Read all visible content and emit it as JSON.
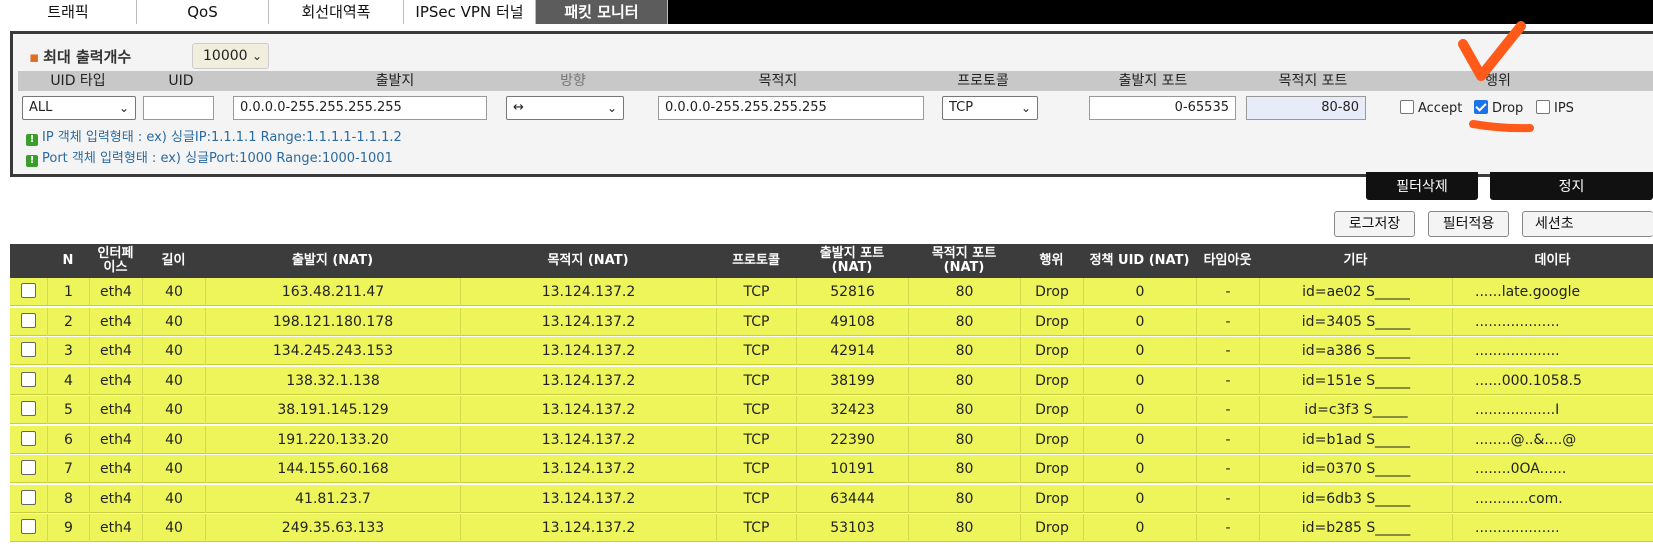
{
  "tabs": [
    {
      "label": "트래픽",
      "active": false
    },
    {
      "label": "QoS",
      "active": false
    },
    {
      "label": "회선대역폭",
      "active": false
    },
    {
      "label": "IPSec VPN 터널",
      "active": false
    },
    {
      "label": "패킷 모니터",
      "active": true
    }
  ],
  "filter": {
    "max_output_label": "최대 출력개수",
    "max_output_value": "10000",
    "headers": {
      "uid_type": "UID 타입",
      "uid": "UID",
      "source": "출발지",
      "direction": "방향",
      "destination": "목적지",
      "protocol": "프로토콜",
      "source_port": "출발지 포트",
      "dest_port": "목적지 포트",
      "action": "행위"
    },
    "uid_type_value": "ALL",
    "uid_value": "",
    "source_value": "0.0.0.0-255.255.255.255",
    "direction_value": "↔",
    "destination_value": "0.0.0.0-255.255.255.255",
    "protocol_value": "TCP",
    "source_port_value": "0-65535",
    "dest_port_value": "80-80",
    "actions": [
      {
        "label": "Accept",
        "checked": false
      },
      {
        "label": "Drop",
        "checked": true
      },
      {
        "label": "IPS",
        "checked": false
      }
    ],
    "notes": [
      "IP 객체 입력형태 : ex) 싱글IP:1.1.1.1 Range:1.1.1.1-1.1.1.2",
      "Port 객체 입력형태 : ex) 싱글Port:1000 Range:1000-1001"
    ]
  },
  "buttons": {
    "filter_delete": "필터삭제",
    "stop": "정지",
    "log_save": "로그저장",
    "filter_apply": "필터적용",
    "session": "세션초"
  },
  "table": {
    "headers": [
      "N",
      "인터페\n이스",
      "길이",
      "출발지 (NAT)",
      "목적지 (NAT)",
      "프로토콜",
      "출발지 포트\n(NAT)",
      "목적지 포트\n(NAT)",
      "행위",
      "정책 UID (NAT)",
      "타임아웃",
      "기타",
      "데이타"
    ],
    "rows": [
      {
        "n": "1",
        "iface": "eth4",
        "len": "40",
        "src": "163.48.211.47",
        "dst": "13.124.137.2",
        "proto": "TCP",
        "sport": "52816",
        "dport": "80",
        "action": "Drop",
        "uid": "0",
        "timeout": "-",
        "etc": "id=ae02 S_____",
        "data": "......late.google"
      },
      {
        "n": "2",
        "iface": "eth4",
        "len": "40",
        "src": "198.121.180.178",
        "dst": "13.124.137.2",
        "proto": "TCP",
        "sport": "49108",
        "dport": "80",
        "action": "Drop",
        "uid": "0",
        "timeout": "-",
        "etc": "id=3405 S_____",
        "data": "..................."
      },
      {
        "n": "3",
        "iface": "eth4",
        "len": "40",
        "src": "134.245.243.153",
        "dst": "13.124.137.2",
        "proto": "TCP",
        "sport": "42914",
        "dport": "80",
        "action": "Drop",
        "uid": "0",
        "timeout": "-",
        "etc": "id=a386 S_____",
        "data": "..................."
      },
      {
        "n": "4",
        "iface": "eth4",
        "len": "40",
        "src": "138.32.1.138",
        "dst": "13.124.137.2",
        "proto": "TCP",
        "sport": "38199",
        "dport": "80",
        "action": "Drop",
        "uid": "0",
        "timeout": "-",
        "etc": "id=151e S_____",
        "data": "......000.1058.5"
      },
      {
        "n": "5",
        "iface": "eth4",
        "len": "40",
        "src": "38.191.145.129",
        "dst": "13.124.137.2",
        "proto": "TCP",
        "sport": "32423",
        "dport": "80",
        "action": "Drop",
        "uid": "0",
        "timeout": "-",
        "etc": "id=c3f3 S_____",
        "data": "..................I"
      },
      {
        "n": "6",
        "iface": "eth4",
        "len": "40",
        "src": "191.220.133.20",
        "dst": "13.124.137.2",
        "proto": "TCP",
        "sport": "22390",
        "dport": "80",
        "action": "Drop",
        "uid": "0",
        "timeout": "-",
        "etc": "id=b1ad S_____",
        "data": "........@..&....@"
      },
      {
        "n": "7",
        "iface": "eth4",
        "len": "40",
        "src": "144.155.60.168",
        "dst": "13.124.137.2",
        "proto": "TCP",
        "sport": "10191",
        "dport": "80",
        "action": "Drop",
        "uid": "0",
        "timeout": "-",
        "etc": "id=0370 S_____",
        "data": "........0OA......"
      },
      {
        "n": "8",
        "iface": "eth4",
        "len": "40",
        "src": "41.81.23.7",
        "dst": "13.124.137.2",
        "proto": "TCP",
        "sport": "63444",
        "dport": "80",
        "action": "Drop",
        "uid": "0",
        "timeout": "-",
        "etc": "id=6db3 S_____",
        "data": "............com."
      },
      {
        "n": "9",
        "iface": "eth4",
        "len": "40",
        "src": "249.35.63.133",
        "dst": "13.124.137.2",
        "proto": "TCP",
        "sport": "53103",
        "dport": "80",
        "action": "Drop",
        "uid": "0",
        "timeout": "-",
        "etc": "id=b285 S_____",
        "data": "..................."
      }
    ]
  },
  "colors": {
    "row_highlight": "#eef55a",
    "annotation": "#ff5a1a",
    "checkbox_checked": "#1a73e8"
  }
}
